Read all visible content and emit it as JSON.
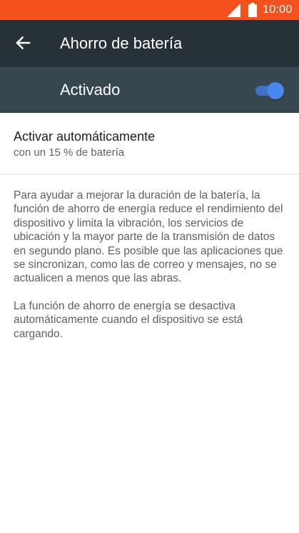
{
  "status_bar": {
    "time": "10:00",
    "icons": [
      "signal-icon",
      "battery-icon"
    ],
    "background_color": "#f4511e"
  },
  "app_bar": {
    "back_icon": "arrow-left-icon",
    "title": "Ahorro de batería",
    "background_color": "#263238"
  },
  "master_switch": {
    "label": "Activado",
    "checked": true,
    "background_color": "#37474f",
    "accent_color": "#4a86ef"
  },
  "auto_activate": {
    "title": "Activar automáticamente",
    "summary": "con un 15 % de batería"
  },
  "description": {
    "paragraph1": "Para ayudar a mejorar la duración de la batería, la función de ahorro de energía reduce el rendimiento del dispositivo y limita la vibración, los servicios de ubicación y la mayor parte de la transmisión de datos en segundo plano. Es posible que las aplicaciones que se sincronizan, como las de correo y mensajes, no se actualicen a menos que las abras.",
    "paragraph2": "La función de ahorro de energía se desactiva automáticamente cuando el dispositivo se está cargando."
  }
}
